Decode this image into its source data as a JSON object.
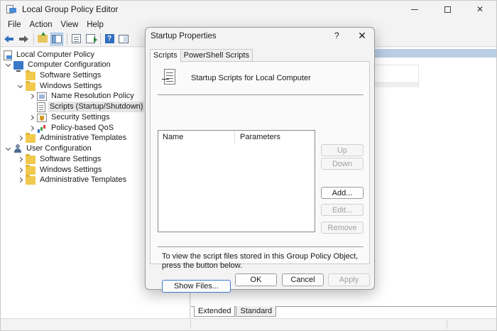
{
  "window": {
    "title": "Local Group Policy Editor"
  },
  "menu": [
    "File",
    "Action",
    "View",
    "Help"
  ],
  "tree": {
    "root": "Local Computer Policy",
    "computer_config": "Computer Configuration",
    "cc_software": "Software Settings",
    "cc_windows": "Windows Settings",
    "name_resolution": "Name Resolution Policy",
    "scripts": "Scripts (Startup/Shutdown)",
    "security": "Security Settings",
    "qos": "Policy-based QoS",
    "cc_admin": "Administrative Templates",
    "user_config": "User Configuration",
    "uc_software": "Software Settings",
    "uc_windows": "Windows Settings",
    "uc_admin": "Administrative Templates"
  },
  "bottom_tabs": {
    "extended": "Extended",
    "standard": "Standard"
  },
  "dialog": {
    "title": "Startup Properties",
    "help_label": "?",
    "tabs": {
      "scripts": "Scripts",
      "powershell": "PowerShell Scripts"
    },
    "header_label": "Startup Scripts for Local Computer",
    "columns": {
      "name": "Name",
      "parameters": "Parameters"
    },
    "buttons": {
      "up": "Up",
      "down": "Down",
      "add": "Add...",
      "edit": "Edit...",
      "remove": "Remove",
      "show_files": "Show Files...",
      "ok": "OK",
      "cancel": "Cancel",
      "apply": "Apply"
    },
    "info_text": "To view the script files stored in this Group Policy Object, press the button below."
  }
}
